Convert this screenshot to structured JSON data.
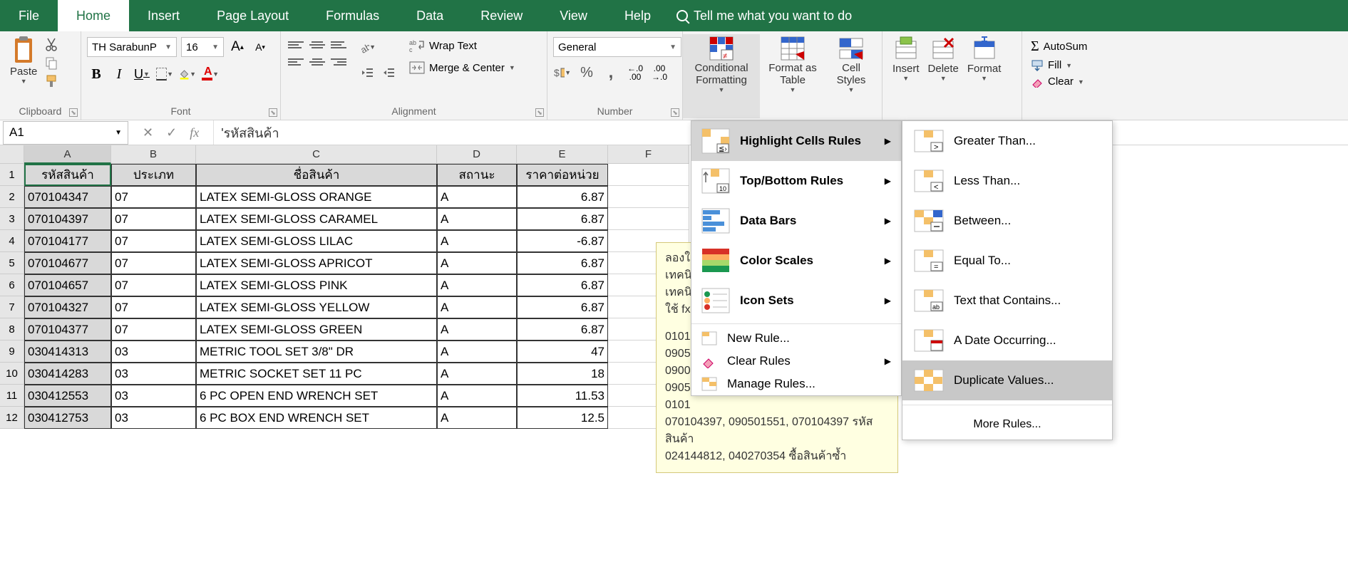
{
  "tabs": [
    "File",
    "Home",
    "Insert",
    "Page Layout",
    "Formulas",
    "Data",
    "Review",
    "View",
    "Help"
  ],
  "active_tab": "Home",
  "tellme": "Tell me what you want to do",
  "clipboard": {
    "paste": "Paste",
    "label": "Clipboard"
  },
  "font": {
    "name": "TH SarabunP",
    "size": "16",
    "bold": "B",
    "italic": "I",
    "underline": "U",
    "grow": "A",
    "shrink": "A",
    "label": "Font"
  },
  "alignment": {
    "wrap": "Wrap Text",
    "merge": "Merge & Center",
    "label": "Alignment"
  },
  "number": {
    "format": "General",
    "label": "Number"
  },
  "styles": {
    "cf": "Conditional Formatting",
    "fat": "Format as Table",
    "cs": "Cell Styles"
  },
  "cells": {
    "insert": "Insert",
    "delete": "Delete",
    "format": "Format"
  },
  "editing": {
    "autosum": "AutoSum",
    "fill": "Fill",
    "clear": "Clear"
  },
  "namebox": "A1",
  "formula": "'รหัสสินค้า",
  "columns": [
    "A",
    "B",
    "C",
    "D",
    "E",
    "F"
  ],
  "headers": [
    "รหัสสินค้า",
    "ประเภท",
    "ชื่อสินค้า",
    "สถานะ",
    "ราคาต่อหน่วย"
  ],
  "rows": [
    [
      "070104347",
      "07",
      "LATEX SEMI-GLOSS ORANGE",
      "A",
      "6.87"
    ],
    [
      "070104397",
      "07",
      "LATEX SEMI-GLOSS CARAMEL",
      "A",
      "6.87"
    ],
    [
      "070104177",
      "07",
      "LATEX SEMI-GLOSS LILAC",
      "A",
      "-6.87"
    ],
    [
      "070104677",
      "07",
      "LATEX SEMI-GLOSS APRICOT",
      "A",
      "6.87"
    ],
    [
      "070104657",
      "07",
      "LATEX SEMI-GLOSS PINK",
      "A",
      "6.87"
    ],
    [
      "070104327",
      "07",
      "LATEX SEMI-GLOSS YELLOW",
      "A",
      "6.87"
    ],
    [
      "070104377",
      "07",
      "LATEX SEMI-GLOSS GREEN",
      "A",
      "6.87"
    ],
    [
      "030414313",
      "03",
      "METRIC TOOL SET 3/8\" DR",
      "A",
      "47"
    ],
    [
      "030414283",
      "03",
      "METRIC SOCKET SET  11 PC",
      "A",
      "18"
    ],
    [
      "030412553",
      "03",
      "6 PC OPEN END WRENCH SET",
      "A",
      "11.53"
    ],
    [
      "030412753",
      "03",
      "6 PC BOX END WRENCH SET",
      "A",
      "12.5"
    ]
  ],
  "tooltip": {
    "l1": "ลองใช้",
    "l2": "เทคนิ",
    "l3": "เทคนิ",
    "l4": "ใช้ fx",
    "l5": "0101",
    "l6": "0905",
    "l7": "0900",
    "l8": "0905",
    "l9": "0101",
    "l10": "070104397, 090501551, 070104397  รหัสสินค้า",
    "l11": "024144812, 040270354 ซื้อสินค้าซ้ำ"
  },
  "cf_menu": {
    "highlight": "Highlight Cells Rules",
    "topbottom": "Top/Bottom Rules",
    "databars": "Data Bars",
    "colorscales": "Color Scales",
    "iconsets": "Icon Sets",
    "newrule": "New Rule...",
    "clear": "Clear Rules",
    "manage": "Manage Rules..."
  },
  "sub_menu": {
    "gt": "Greater Than...",
    "lt": "Less Than...",
    "bw": "Between...",
    "eq": "Equal To...",
    "tc": "Text that Contains...",
    "do": "A Date Occurring...",
    "dv": "Duplicate Values...",
    "more": "More Rules..."
  }
}
